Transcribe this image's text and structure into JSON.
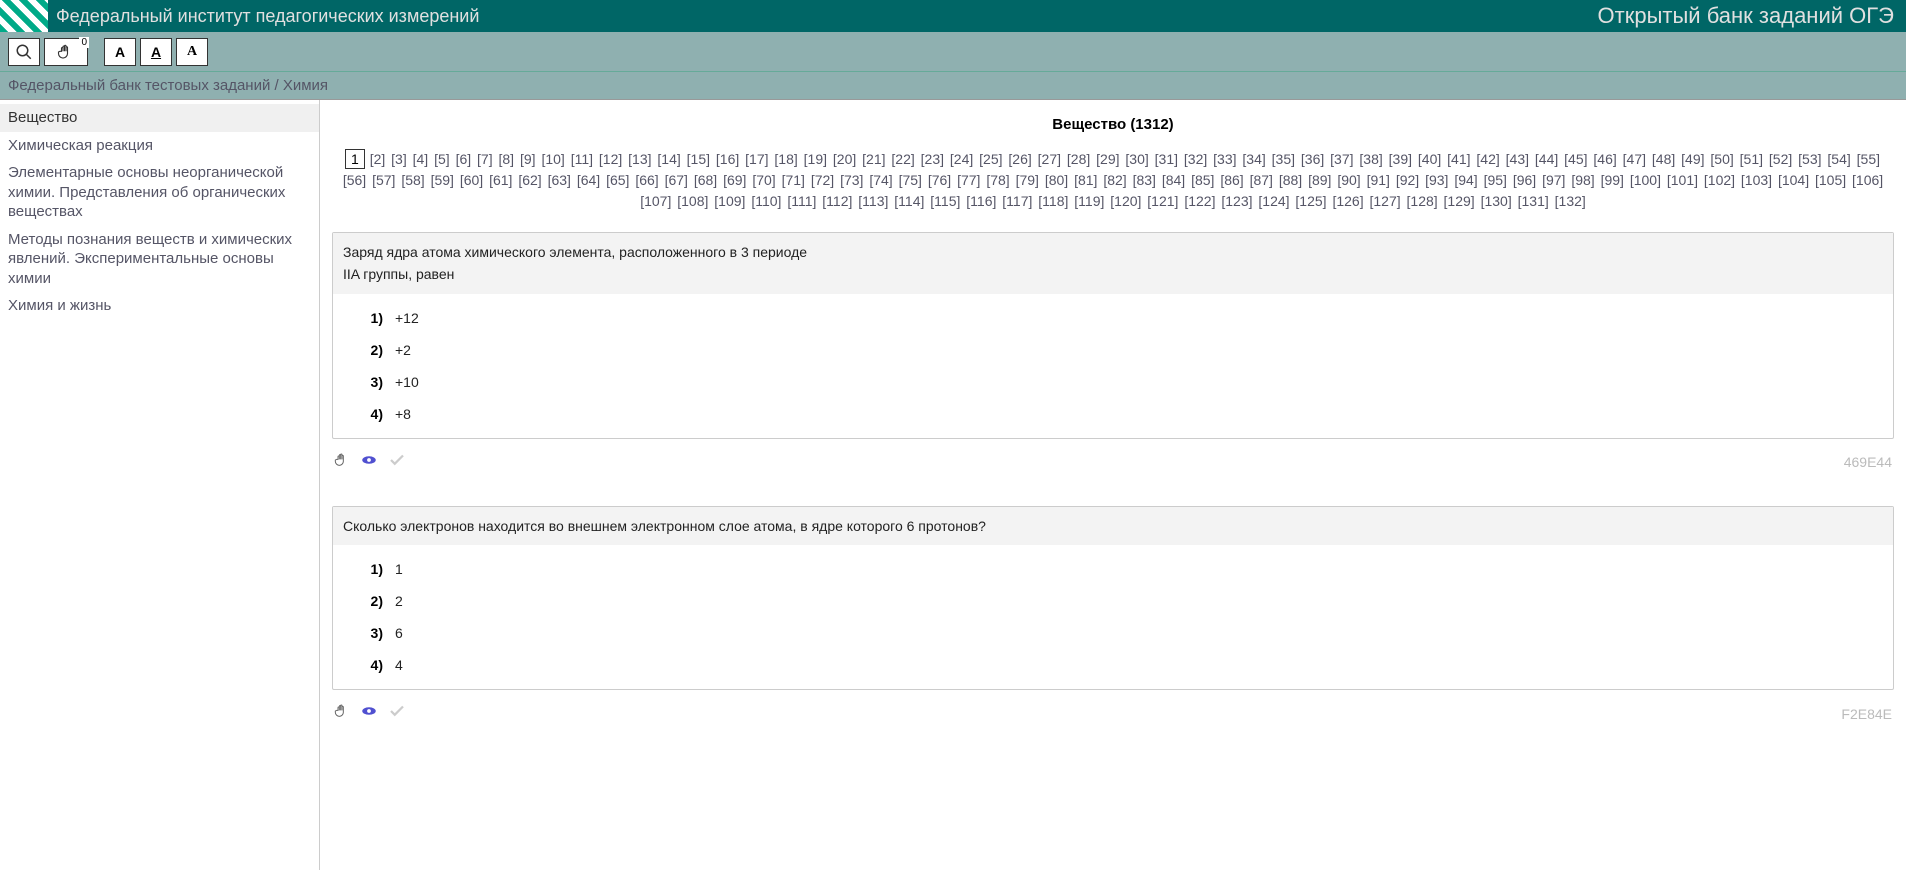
{
  "header": {
    "site_title": "Федеральный институт педагогических измерений",
    "bank_title": "Открытый банк заданий ОГЭ"
  },
  "toolbar": {
    "hand_badge": "0"
  },
  "breadcrumb": "Федеральный банк тестовых заданий / Химия",
  "sidebar": {
    "items": [
      {
        "label": "Вещество",
        "active": true
      },
      {
        "label": "Химическая реакция",
        "active": false
      },
      {
        "label": "Элементарные основы неорганической химии. Представления об органических веществах",
        "active": false
      },
      {
        "label": "Методы познания веществ и химических явлений. Экспериментальные основы химии",
        "active": false
      },
      {
        "label": "Химия и жизнь",
        "active": false
      }
    ]
  },
  "main": {
    "title": "Вещество (1312)",
    "total_pages": 132,
    "current_page": 1
  },
  "questions": [
    {
      "id": "469E44",
      "lines": [
        "Заряд ядра атома химического элемента, расположенного в 3 периоде",
        "IIA группы, равен"
      ],
      "answers": [
        {
          "num": "1)",
          "val": "+12"
        },
        {
          "num": "2)",
          "val": "+2"
        },
        {
          "num": "3)",
          "val": "+10"
        },
        {
          "num": "4)",
          "val": "+8"
        }
      ]
    },
    {
      "id": "F2E84E",
      "lines": [
        "Сколько электронов находится во внешнем электронном слое атома, в ядре которого 6 протонов?"
      ],
      "answers": [
        {
          "num": "1)",
          "val": "1"
        },
        {
          "num": "2)",
          "val": "2"
        },
        {
          "num": "3)",
          "val": "6"
        },
        {
          "num": "4)",
          "val": "4"
        }
      ]
    }
  ]
}
